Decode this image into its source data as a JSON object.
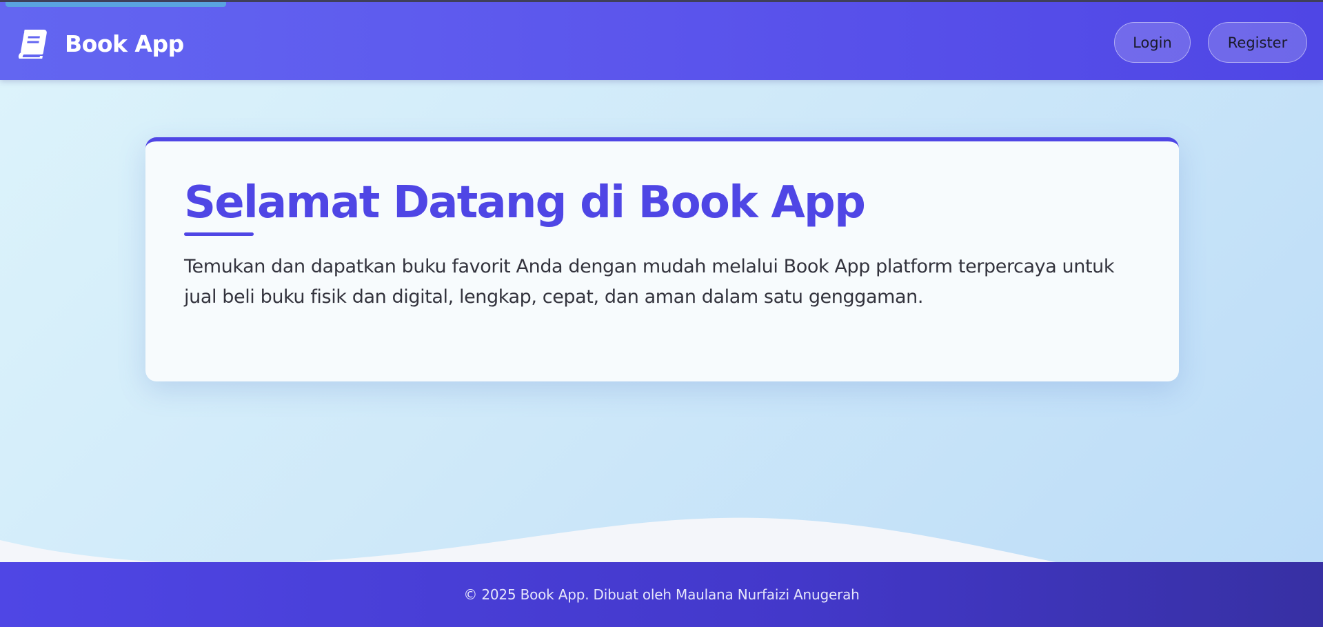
{
  "navbar": {
    "brand_icon": "book-icon",
    "brand_name": "Book App",
    "login_label": "Login",
    "register_label": "Register"
  },
  "hero": {
    "title": "Selamat Datang di Book App",
    "description": "Temukan dan dapatkan buku favorit Anda dengan mudah melalui Book App platform terpercaya untuk jual beli buku fisik dan digital, lengkap, cepat, dan aman dalam satu genggaman."
  },
  "footer": {
    "text": "© 2025 Book App. Dibuat oleh Maulana Nurfaizi Anugerah"
  },
  "colors": {
    "primary": "#4f46e5",
    "navbar": "#6366f1",
    "hero_bg": "#cfe9f9",
    "card_bg": "#f7fbfd",
    "footer": "#4338ca"
  }
}
